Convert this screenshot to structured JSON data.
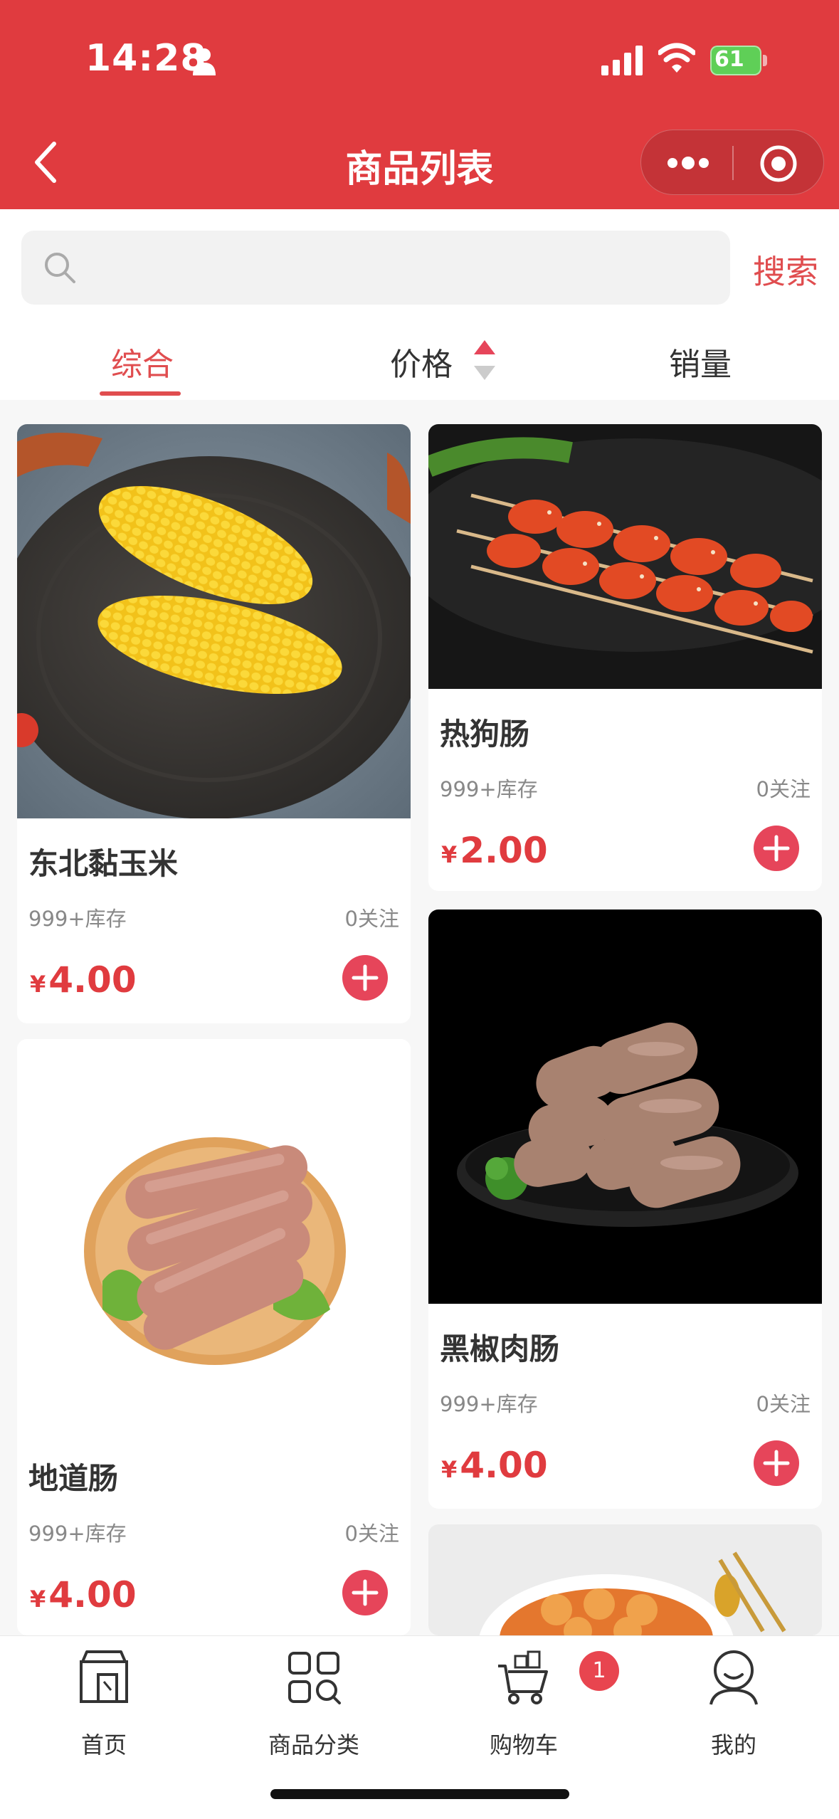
{
  "status_bar": {
    "time": "14:28",
    "battery": "61"
  },
  "nav": {
    "title": "商品列表"
  },
  "search": {
    "placeholder": "",
    "button_label": "搜索"
  },
  "sort_tabs": [
    {
      "label": "综合",
      "active": true
    },
    {
      "label": "价格",
      "active": false
    },
    {
      "label": "销量",
      "active": false
    }
  ],
  "products": [
    {
      "name": "东北黏玉米",
      "stock": "999+库存",
      "follow": "0关注",
      "currency": "¥",
      "price": "4.00",
      "image": "corn"
    },
    {
      "name": "热狗肠",
      "stock": "999+库存",
      "follow": "0关注",
      "currency": "¥",
      "price": "2.00",
      "image": "sausage-skewers"
    },
    {
      "name": "地道肠",
      "stock": "999+库存",
      "follow": "0关注",
      "currency": "¥",
      "price": "4.00",
      "image": "sausage-plate"
    },
    {
      "name": "黑椒肉肠",
      "stock": "999+库存",
      "follow": "0关注",
      "currency": "¥",
      "price": "4.00",
      "image": "pepper-sausage"
    },
    {
      "name": "",
      "image": "soup-bowl"
    }
  ],
  "tabbar": {
    "items": [
      {
        "label": "首页",
        "icon": "store-icon"
      },
      {
        "label": "商品分类",
        "icon": "category-icon"
      },
      {
        "label": "购物车",
        "icon": "cart-icon"
      },
      {
        "label": "我的",
        "icon": "user-icon"
      }
    ],
    "cart_badge": "1"
  },
  "colors": {
    "primary": "#e03b3f",
    "accent": "#e6455a"
  }
}
